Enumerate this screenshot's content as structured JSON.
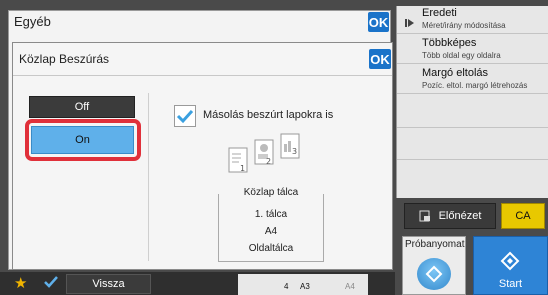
{
  "background_panel": {
    "title": "Egyéb",
    "ok_label": "OK"
  },
  "dialog": {
    "title": "Közlap Beszúrás",
    "ok_label": "OK",
    "off_label": "Off",
    "on_label": "On",
    "checkbox_label": "Másolás beszúrt lapokra is",
    "checkbox_checked": true,
    "tray": {
      "title": "Közlap tálca",
      "tray": "1. tálca",
      "size": "A4",
      "type": "Oldaltálca"
    }
  },
  "right_menu": [
    {
      "title": "Eredeti",
      "subtitle": "Méret/irány módosítása"
    },
    {
      "title": "Többképes",
      "subtitle": "Több oldal egy oldalra"
    },
    {
      "title": "Margó eltolás",
      "subtitle": "Pozíc. eltol. margó létrehozás"
    }
  ],
  "preview_label": "Előnézet",
  "ca_label": "CA",
  "proba_label": "Próbanyomat",
  "start_label": "Start",
  "bottom": {
    "back_label": "Vissza",
    "strip": [
      "4",
      "A3",
      "A4"
    ]
  },
  "colors": {
    "accent_blue": "#1a73c9",
    "highlight_red": "#e0303a",
    "ca_yellow": "#e8c800"
  }
}
